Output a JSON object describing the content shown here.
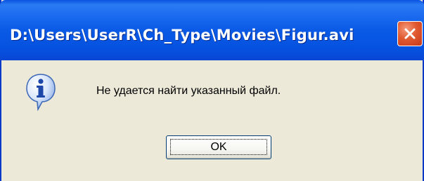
{
  "dialog": {
    "title": "D:\\Users\\UserR\\Ch_Type\\Movies\\Figur.avi",
    "message": "Не удается найти указанный файл.",
    "ok_label": "OK",
    "icon": "info-icon",
    "close_icon": "close-icon"
  },
  "colors": {
    "titlebar": "#0a5ae6",
    "window_bg": "#ece9d8",
    "close_button": "#e0592f",
    "button_border": "#003c74"
  }
}
